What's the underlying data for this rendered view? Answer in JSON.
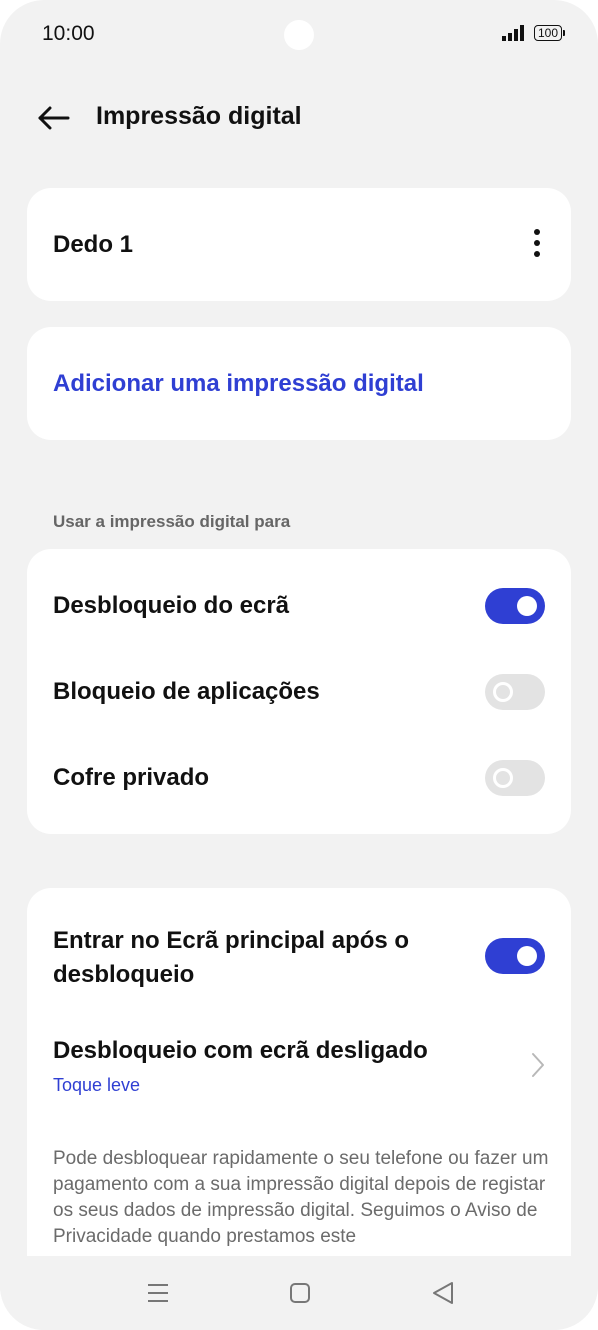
{
  "status_bar": {
    "time": "10:00",
    "battery": "100",
    "icons": [
      "signal-icon",
      "battery-icon"
    ]
  },
  "header": {
    "title": "Impressão digital",
    "back_icon": "arrow-left-icon"
  },
  "fingerprints": {
    "items": [
      {
        "label": "Dedo 1",
        "menu_icon": "more-vertical-icon"
      }
    ],
    "add_label": "Adicionar uma impressão digital"
  },
  "usage": {
    "header": "Usar a impressão digital para",
    "items": [
      {
        "label": "Desbloqueio do ecrã",
        "enabled": true
      },
      {
        "label": "Bloqueio de aplicações",
        "enabled": false
      },
      {
        "label": "Cofre privado",
        "enabled": false
      }
    ]
  },
  "options": {
    "home_after_unlock": {
      "label": "Entrar no Ecrã principal após o desbloqueio",
      "enabled": true
    },
    "screen_off_unlock": {
      "label": "Desbloqueio com ecrã desligado",
      "value": "Toque leve",
      "icon": "chevron-right-icon"
    },
    "description": "Pode desbloquear rapidamente o seu telefone ou fazer um pagamento com a sua impressão digital depois de registar os seus dados de impressão digital. Seguimos o Aviso de Privacidade quando prestamos este"
  },
  "navbar": {
    "icons": [
      "menu-icon",
      "home-square-icon",
      "back-triangle-icon"
    ]
  },
  "colors": {
    "accent": "#2f3fd3",
    "background": "#f2f2f2",
    "card": "#ffffff",
    "toggle_off": "#e3e3e3"
  }
}
